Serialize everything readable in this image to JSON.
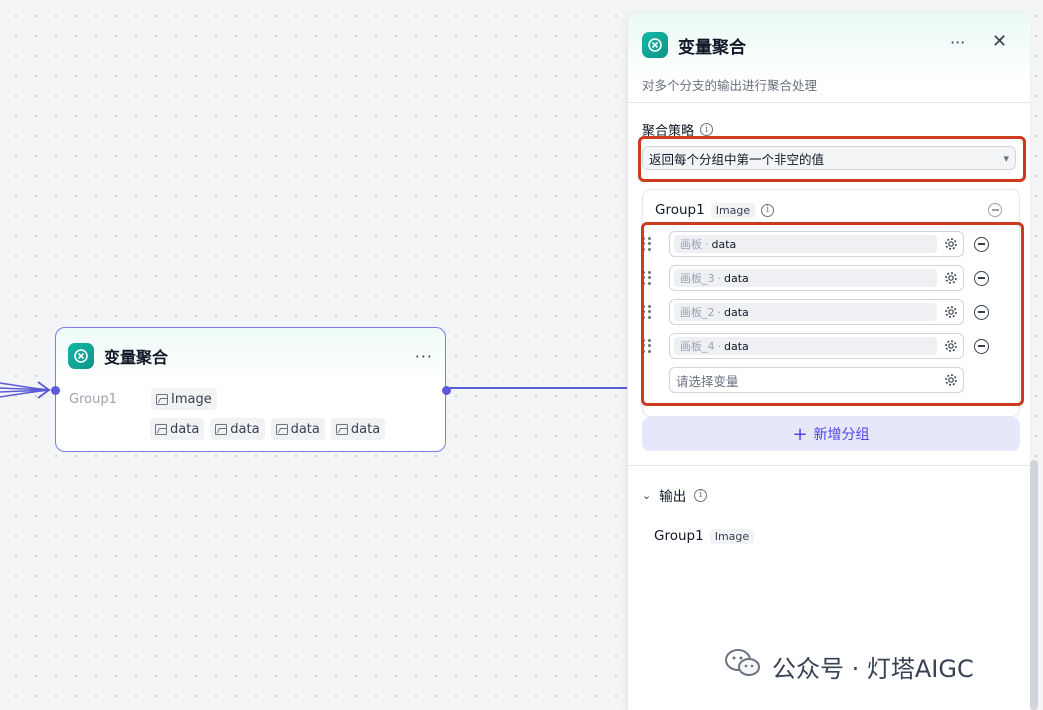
{
  "node": {
    "title": "变量聚合",
    "more": "···",
    "group_label": "Group1",
    "output_type": "Image",
    "inputs": [
      "data",
      "data",
      "data",
      "data"
    ]
  },
  "panel": {
    "title": "变量聚合",
    "more": "···",
    "close": "✕",
    "description": "对多个分支的输出进行聚合处理",
    "strategy_label": "聚合策略",
    "strategy_value": "返回每个分组中第一个非空的值",
    "group": {
      "name": "Group1",
      "type": "Image",
      "variables": [
        {
          "source": "画板",
          "name": "data"
        },
        {
          "source": "画板_3",
          "name": "data"
        },
        {
          "source": "画板_2",
          "name": "data"
        },
        {
          "source": "画板_4",
          "name": "data"
        }
      ],
      "placeholder": "请选择变量"
    },
    "add_group": "新增分组",
    "output_label": "输出",
    "output": {
      "name": "Group1",
      "type": "Image"
    }
  },
  "watermark": "公众号 · 灯塔AIGC",
  "colors": {
    "accent": "#5b5bd6",
    "highlight": "#cc3b1f",
    "app_icon": "#14b8a6"
  }
}
